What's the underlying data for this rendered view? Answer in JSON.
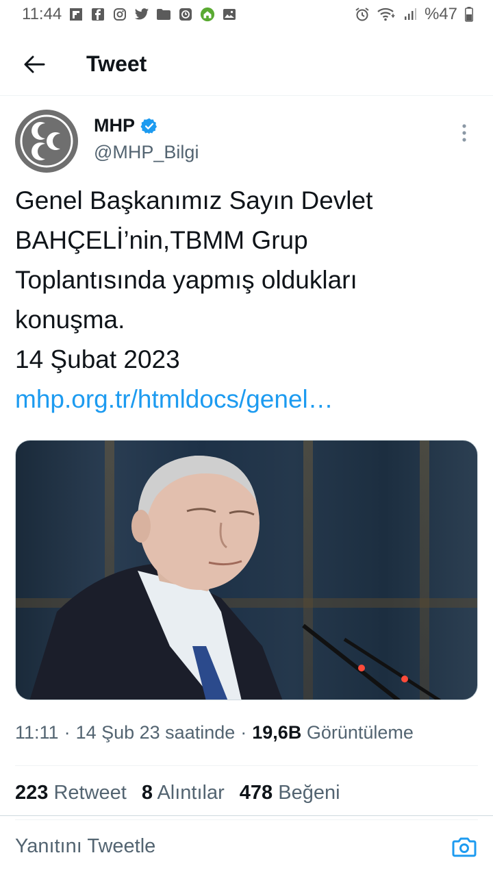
{
  "status_bar": {
    "time": "11:44",
    "battery": "%47"
  },
  "header": {
    "title": "Tweet"
  },
  "tweet": {
    "author_name": "MHP",
    "handle": "@MHP_Bilgi",
    "text": "Genel Başkanımız Sayın Devlet\nBAHÇELİ’nin,TBMM Grup\nToplantısında yapmış oldukları\nkonuşma.\n14 Şubat 2023",
    "link": "mhp.org.tr/htmldocs/genel…",
    "meta": {
      "time": "11:11",
      "sep1": "·",
      "date": "14 Şub 23 saatinde",
      "sep2": "·",
      "views_count": "19,6B",
      "views_label": "Görüntüleme"
    },
    "stats": {
      "retweets_count": "223",
      "retweets_label": "Retweet",
      "quotes_count": "8",
      "quotes_label": "Alıntılar",
      "likes_count": "478",
      "likes_label": "Beğeni"
    }
  },
  "reply": {
    "placeholder": "Yanıtını Tweetle"
  },
  "colors": {
    "accent": "#1d9bf0",
    "text_primary": "#0f1419",
    "text_secondary": "#536471"
  }
}
